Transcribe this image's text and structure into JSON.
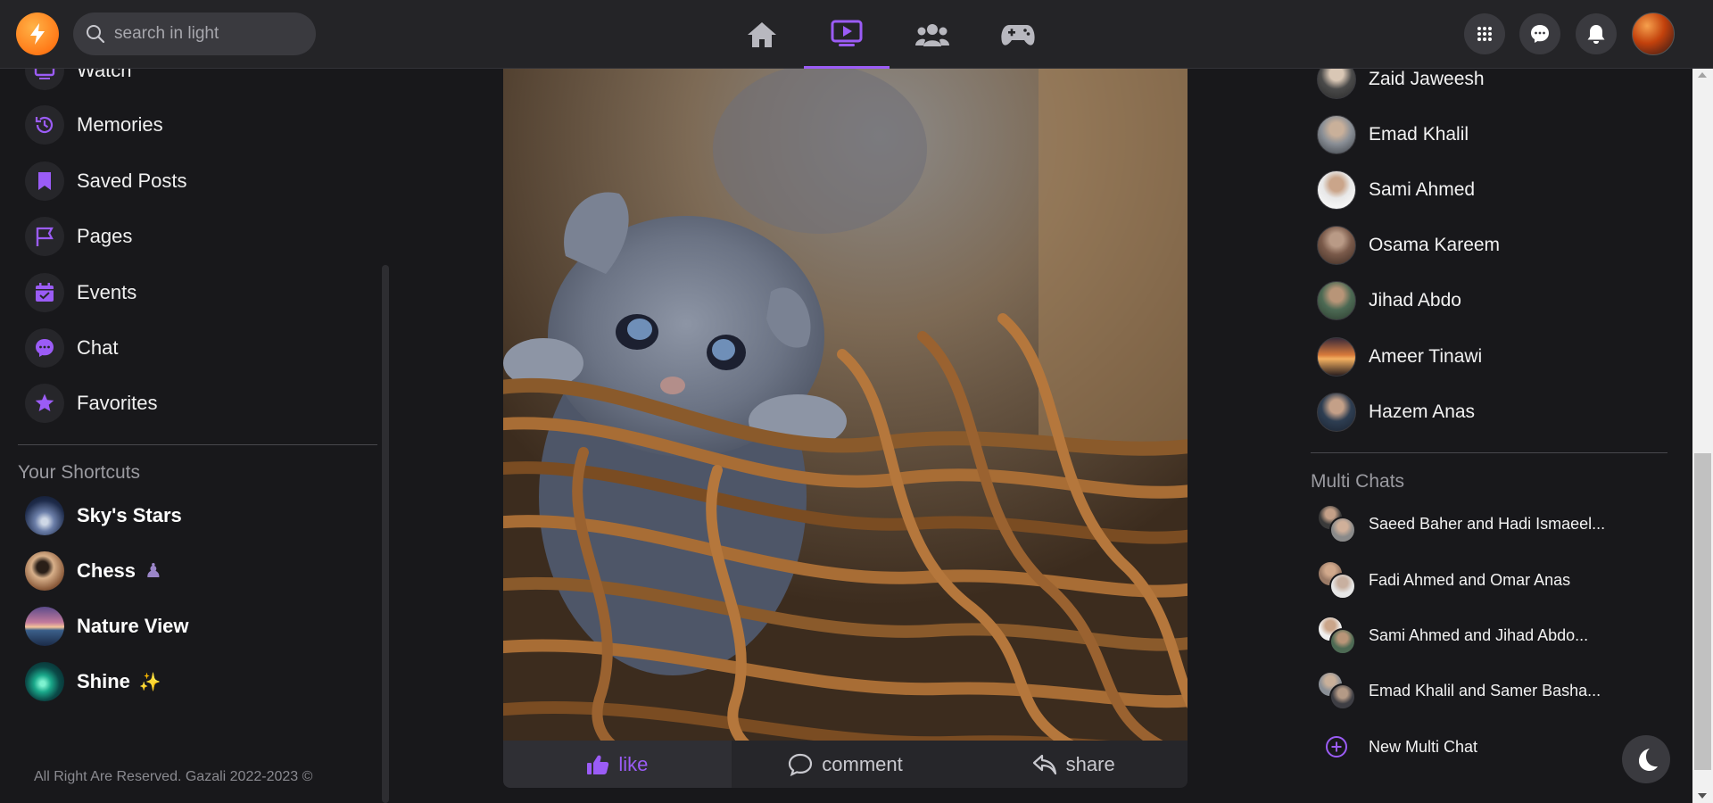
{
  "header": {
    "search_placeholder": "search in light",
    "nav_tabs": [
      {
        "icon": "home-icon",
        "active": false
      },
      {
        "icon": "watch-icon",
        "active": true
      },
      {
        "icon": "groups-icon",
        "active": false
      },
      {
        "icon": "gaming-icon",
        "active": false
      }
    ],
    "actions": [
      "menu-grid-icon",
      "messenger-icon",
      "bell-icon"
    ]
  },
  "sidebar": {
    "items": [
      {
        "label": "Watch",
        "icon": "watch-icon"
      },
      {
        "label": "Memories",
        "icon": "history-icon"
      },
      {
        "label": "Saved Posts",
        "icon": "bookmark-icon"
      },
      {
        "label": "Pages",
        "icon": "flag-icon"
      },
      {
        "label": "Events",
        "icon": "calendar-icon"
      },
      {
        "label": "Chat",
        "icon": "chat-icon"
      },
      {
        "label": "Favorites",
        "icon": "star-icon"
      }
    ],
    "shortcuts_title": "Your Shortcuts",
    "shortcuts": [
      {
        "label": "Sky's Stars"
      },
      {
        "label": "Chess",
        "emoji": "♟"
      },
      {
        "label": "Nature View"
      },
      {
        "label": "Shine",
        "emoji": "✨"
      }
    ],
    "footer": "All Right Are Reserved. Gazali 2022-2023 ©"
  },
  "post": {
    "actions": {
      "like": "like",
      "comment": "comment",
      "share": "share"
    }
  },
  "contacts": [
    {
      "name": "Zaid Jaweesh"
    },
    {
      "name": "Emad Khalil"
    },
    {
      "name": "Sami Ahmed"
    },
    {
      "name": "Osama Kareem"
    },
    {
      "name": "Jihad Abdo"
    },
    {
      "name": "Ameer Tinawi"
    },
    {
      "name": "Hazem Anas"
    }
  ],
  "multi_chats": {
    "title": "Multi Chats",
    "items": [
      {
        "name": "Saeed Baher and Hadi Ismaeel..."
      },
      {
        "name": "Fadi Ahmed and Omar Anas"
      },
      {
        "name": "Sami Ahmed and Jihad Abdo..."
      },
      {
        "name": "Emad Khalil and Samer Basha..."
      }
    ],
    "new_label": "New Multi Chat"
  },
  "colors": {
    "accent": "#9b5cf6",
    "background": "#18181b",
    "topbar": "#242427",
    "logo": "#ff7a18"
  }
}
